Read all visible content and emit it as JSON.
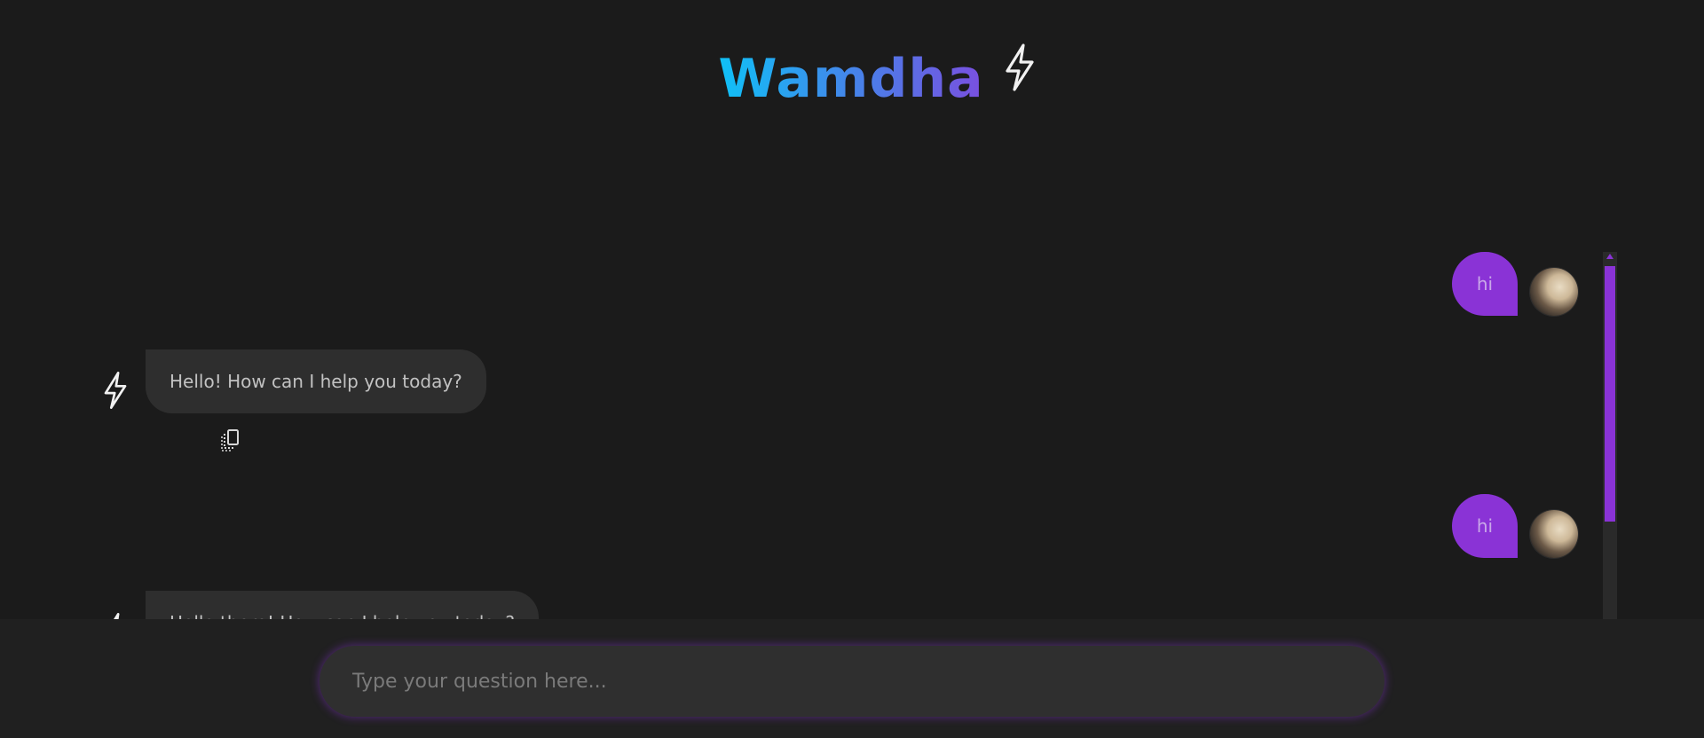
{
  "header": {
    "brand": "Wamdha",
    "bolt_icon": "lightning-bolt-icon"
  },
  "colors": {
    "background": "#1b1b1b",
    "accent_purple": "#8a33d6",
    "brand_gradient_start": "#0fc1f7",
    "brand_gradient_end": "#7a4fe0",
    "bot_bubble": "#2e2e2e"
  },
  "chat": {
    "messages": [
      {
        "role": "user",
        "text": "hi"
      },
      {
        "role": "assistant",
        "text": "Hello! How can I help you today?",
        "action_icon": "copy-icon"
      },
      {
        "role": "user",
        "text": "hi"
      },
      {
        "role": "assistant",
        "text": "Hello there! How can I help you today?"
      }
    ]
  },
  "composer": {
    "placeholder": "Type your question here..."
  }
}
